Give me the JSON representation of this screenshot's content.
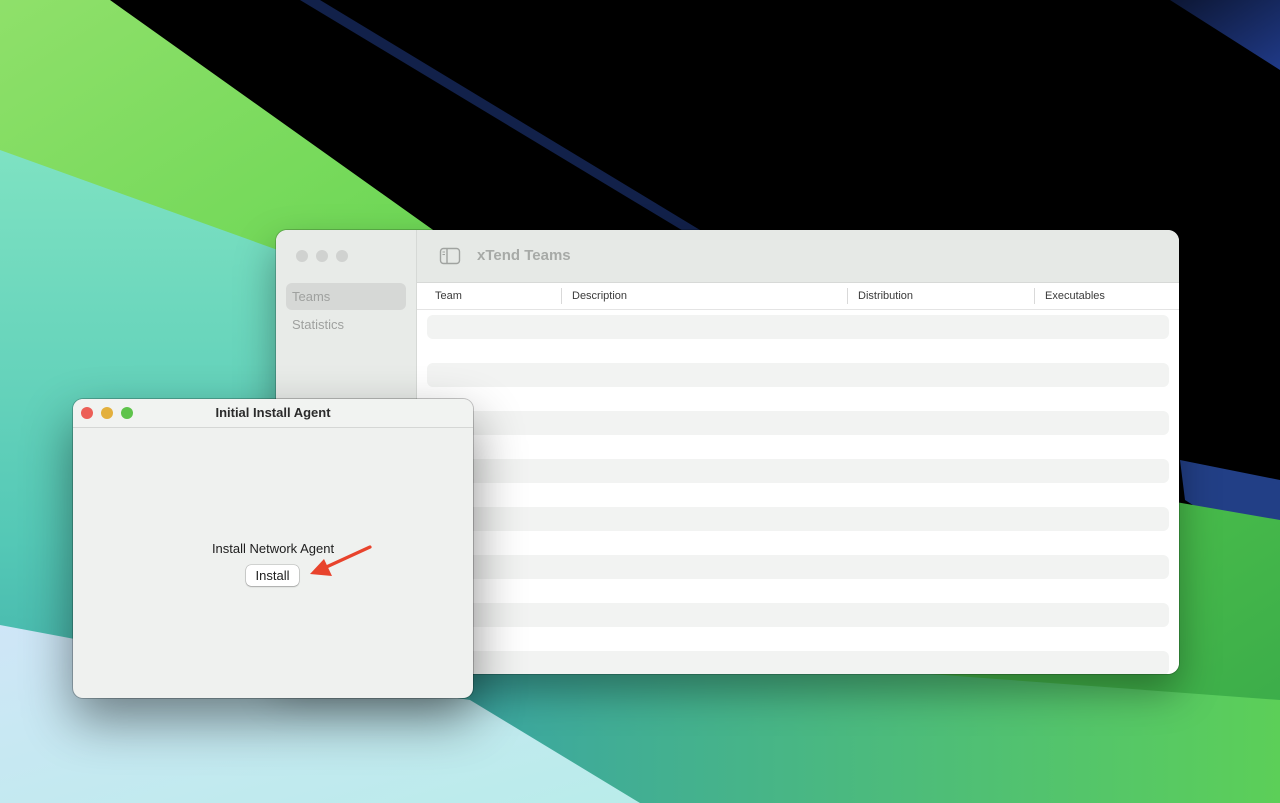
{
  "teams_window": {
    "title": "xTend Teams",
    "sidebar": {
      "items": [
        {
          "label": "Teams",
          "selected": true
        },
        {
          "label": "Statistics",
          "selected": false
        }
      ]
    },
    "table": {
      "columns": [
        "Team",
        "Description",
        "Distribution",
        "Executables"
      ],
      "rows": []
    }
  },
  "install_window": {
    "title": "Initial Install Agent",
    "label": "Install Network Agent",
    "button_label": "Install"
  },
  "colors": {
    "annotation_arrow": "#e8432c",
    "traffic_red": "#ec5f57",
    "traffic_yellow": "#e3b03d",
    "traffic_green": "#5ec34b"
  },
  "icons": {
    "sidebar_toggle": "sidebar-toggle-icon",
    "annotation": "red-arrow-icon"
  }
}
